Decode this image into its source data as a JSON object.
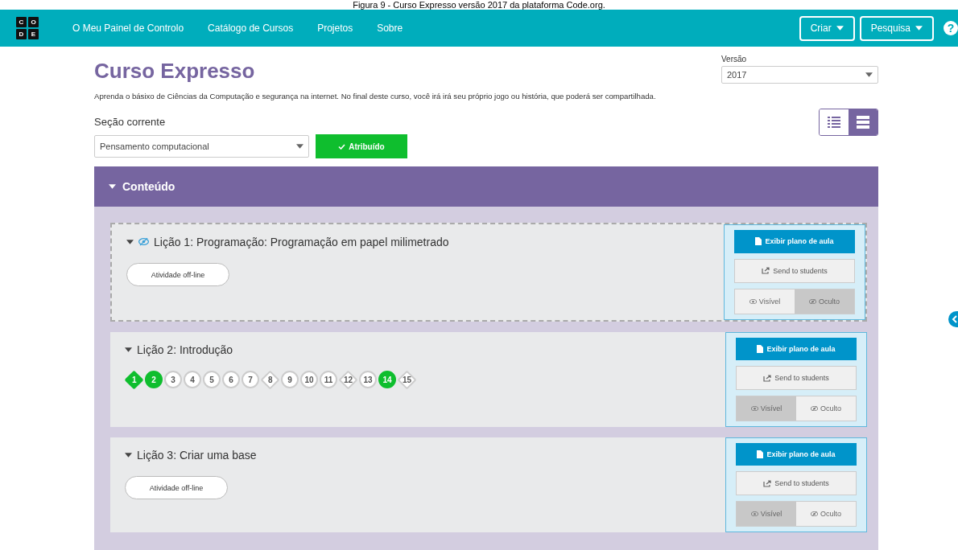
{
  "caption": "Figura 9 - Curso Expresso versão 2017 da plataforma Code.org.",
  "nav": {
    "logo": [
      "C",
      "O",
      "D",
      "E"
    ],
    "links": [
      "O Meu Painel de Controlo",
      "Catálogo de Cursos",
      "Projetos",
      "Sobre"
    ],
    "menus": [
      "Criar",
      "Pesquisa"
    ],
    "help": "?"
  },
  "course": {
    "title": "Curso Expresso",
    "version_label": "Versão",
    "version_value": "2017",
    "description": "Aprenda o básixo de Ciências da Computação e segurança na internet. No final deste curso, você irá irá seu próprio jogo ou história, que poderá ser compartilhada.",
    "section_label": "Seção corrente",
    "section_value": "Pensamento computacional",
    "assigned_button": "Atribuído"
  },
  "view_toggle": [
    {
      "kind": "list",
      "selected": false
    },
    {
      "kind": "block",
      "selected": true
    }
  ],
  "content": {
    "title": "Conteúdo",
    "expanded": true
  },
  "lessons": [
    {
      "title": "Lição 1: Programação: Programação em papel milimetrado",
      "hidden": true,
      "activity": "Atividade off-line",
      "plan_button": "Exibir plano de aula",
      "send_button": "Send to students",
      "visibility": [
        {
          "label": "Visível",
          "selected": false
        },
        {
          "label": "Oculto",
          "selected": true
        }
      ]
    },
    {
      "title": "Lição 2: Introdução",
      "hidden": false,
      "bubbles": [
        {
          "label": "1",
          "kind": "diamond",
          "completed": true
        },
        {
          "label": "2",
          "kind": "circle",
          "completed": true
        },
        {
          "label": "3",
          "kind": "circle",
          "completed": false
        },
        {
          "label": "4",
          "kind": "circle",
          "completed": false
        },
        {
          "label": "5",
          "kind": "circle",
          "completed": false
        },
        {
          "label": "6",
          "kind": "circle",
          "completed": false
        },
        {
          "label": "7",
          "kind": "circle",
          "completed": false
        },
        {
          "label": "8",
          "kind": "diamond",
          "completed": false
        },
        {
          "label": "9",
          "kind": "circle",
          "completed": false
        },
        {
          "label": "10",
          "kind": "circle",
          "completed": false
        },
        {
          "label": "11",
          "kind": "circle",
          "completed": false
        },
        {
          "label": "12",
          "kind": "diamond",
          "completed": false
        },
        {
          "label": "13",
          "kind": "circle",
          "completed": false
        },
        {
          "label": "14",
          "kind": "circle",
          "completed": true
        },
        {
          "label": "15",
          "kind": "diamond",
          "completed": false
        }
      ],
      "plan_button": "Exibir plano de aula",
      "send_button": "Send to students",
      "visibility": [
        {
          "label": "Visível",
          "selected": true
        },
        {
          "label": "Oculto",
          "selected": false
        }
      ]
    },
    {
      "title": "Lição 3: Criar uma base",
      "hidden": false,
      "activity": "Atividade off-line",
      "plan_button": "Exibir plano de aula",
      "send_button": "Send to students",
      "visibility": [
        {
          "label": "Visível",
          "selected": true
        },
        {
          "label": "Oculto",
          "selected": false
        }
      ]
    }
  ]
}
